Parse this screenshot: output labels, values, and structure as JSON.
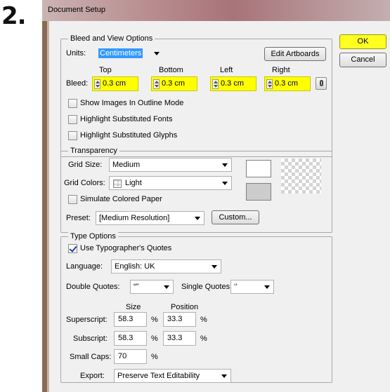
{
  "step_number": "2.",
  "window": {
    "title": "Document Setup"
  },
  "buttons": {
    "ok": "OK",
    "cancel": "Cancel"
  },
  "bleed_view": {
    "legend": "Bleed and View Options",
    "units_label": "Units:",
    "units_value": "Centimeters",
    "edit_artboards": "Edit Artboards",
    "bleed_label": "Bleed:",
    "headers": {
      "top": "Top",
      "bottom": "Bottom",
      "left": "Left",
      "right": "Right"
    },
    "values": {
      "top": "0.3 cm",
      "bottom": "0.3 cm",
      "left": "0.3 cm",
      "right": "0.3 cm"
    },
    "highlight_color": "#ffff00",
    "checkboxes": [
      {
        "label": "Show Images In Outline Mode",
        "checked": false
      },
      {
        "label": "Highlight Substituted Fonts",
        "checked": false
      },
      {
        "label": "Highlight Substituted Glyphs",
        "checked": false
      }
    ]
  },
  "transparency": {
    "legend": "Transparency",
    "grid_size_label": "Grid Size:",
    "grid_size_value": "Medium",
    "grid_colors_label": "Grid Colors:",
    "grid_colors_value": "Light",
    "simulate_label": "Simulate Colored Paper",
    "preset_label": "Preset:",
    "preset_value": "[Medium Resolution]",
    "custom_button": "Custom..."
  },
  "type_options": {
    "legend": "Type Options",
    "typographers_quotes": "Use Typographer's Quotes",
    "language_label": "Language:",
    "language_value": "English: UK",
    "double_quotes_label": "Double Quotes:",
    "double_quotes_value": "“”",
    "single_quotes_label": "Single Quotes:",
    "single_quotes_value": "‘’",
    "size_header": "Size",
    "position_header": "Position",
    "superscript_label": "Superscript:",
    "superscript_size": "58.3",
    "superscript_position": "33.3",
    "subscript_label": "Subscript:",
    "subscript_size": "58.3",
    "subscript_position": "33.3",
    "small_caps_label": "Small Caps:",
    "small_caps_value": "70",
    "percent": "%",
    "export_label": "Export:",
    "export_value": "Preserve Text Editability"
  }
}
